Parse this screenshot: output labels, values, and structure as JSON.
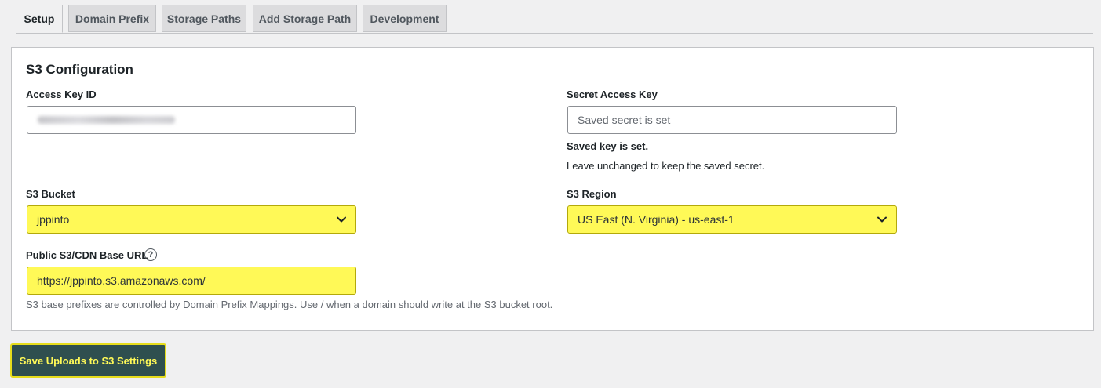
{
  "tabs": [
    {
      "label": "Setup",
      "active": true
    },
    {
      "label": "Domain Prefix",
      "active": false
    },
    {
      "label": "Storage Paths",
      "active": false
    },
    {
      "label": "Add Storage Path",
      "active": false
    },
    {
      "label": "Development",
      "active": false
    }
  ],
  "section": {
    "title": "S3 Configuration",
    "access_key": {
      "label": "Access Key ID",
      "value": ""
    },
    "secret_key": {
      "label": "Secret Access Key",
      "placeholder": "Saved secret is set",
      "status": "Saved key is set.",
      "hint": "Leave unchanged to keep the saved secret."
    },
    "bucket": {
      "label": "S3 Bucket",
      "value": "jppinto"
    },
    "region": {
      "label": "S3 Region",
      "value": "US East (N. Virginia) - us-east-1"
    },
    "base_url": {
      "label": "Public S3/CDN Base URL",
      "help_glyph": "?",
      "value": "https://jppinto.s3.amazonaws.com/",
      "description": "S3 base prefixes are controlled by Domain Prefix Mappings. Use / when a domain should write at the S3 bucket root."
    }
  },
  "actions": {
    "save_label": "Save Uploads to S3 Settings"
  },
  "colors": {
    "highlight": "#fff957",
    "button_bg": "#2f4f4f",
    "button_text": "#fff957",
    "page_bg": "#f0f0f1"
  },
  "icons": {
    "dropdown": "chevron-down-icon",
    "help": "help-icon"
  }
}
